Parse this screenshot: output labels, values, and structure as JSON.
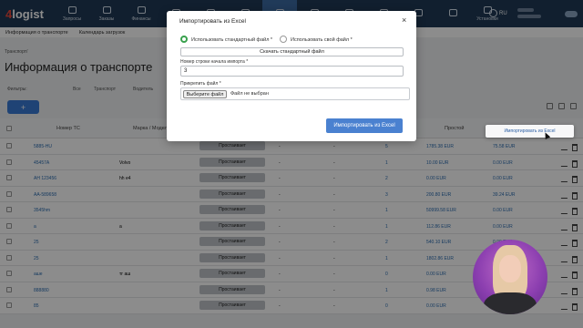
{
  "app": {
    "logo_prefix": "4",
    "logo_text": "logist"
  },
  "nav": {
    "items": [
      "Запросы",
      "Заказы",
      "Финансы",
      "",
      "",
      "",
      "",
      "",
      "",
      "",
      "",
      "",
      "Установки"
    ],
    "active_index": 6
  },
  "header": {
    "lang": "RU"
  },
  "subtabs": [
    "Информация о транспорте",
    "Календарь загрузок"
  ],
  "breadcrumb": "Транспорт/",
  "page_title": "Информация о транспорте",
  "filters": {
    "label": "Фильтры:",
    "options": [
      "Все",
      "Транспорт",
      "Водитель"
    ]
  },
  "add_button": "+",
  "table": {
    "headers": {
      "num": "Номер ТС",
      "brand": "Марка / Модель",
      "idle": "Простой"
    },
    "rows": [
      {
        "num": "5885-HU",
        "brand": "",
        "status": "Простаивает",
        "a": "-",
        "b": "-",
        "count": "5",
        "idle": "1785.38 EUR",
        "idle2": "75.58 EUR"
      },
      {
        "num": "45457А",
        "brand": "Volvo",
        "status": "Простаивает",
        "a": "-",
        "b": "-",
        "count": "1",
        "idle": "10.00 EUR",
        "idle2": "0.00 EUR"
      },
      {
        "num": "АН 123456",
        "brand": "hh e4",
        "status": "Простаивает",
        "a": "-",
        "b": "-",
        "count": "2",
        "idle": "0.00 EUR",
        "idle2": "0.00 EUR"
      },
      {
        "num": "АА-589658",
        "brand": "",
        "status": "Простаивает",
        "a": "-",
        "b": "-",
        "count": "3",
        "idle": "200.80 EUR",
        "idle2": "39.24 EUR"
      },
      {
        "num": "3545hm",
        "brand": "",
        "status": "Простаивает",
        "a": "-",
        "b": "-",
        "count": "1",
        "idle": "50999.58 EUR",
        "idle2": "0.00 EUR"
      },
      {
        "num": "a",
        "brand": "a",
        "status": "Простаивает",
        "a": "-",
        "b": "-",
        "count": "1",
        "idle": "112.86 EUR",
        "idle2": "0.00 EUR"
      },
      {
        "num": "25",
        "brand": "",
        "status": "Простаивает",
        "a": "-",
        "b": "-",
        "count": "2",
        "idle": "540.10 EUR",
        "idle2": "0.00 EUR"
      },
      {
        "num": "25",
        "brand": "",
        "status": "Простаивает",
        "a": "-",
        "b": "-",
        "count": "1",
        "idle": "1802.86 EUR",
        "idle2": "0.00 EUR"
      },
      {
        "num": "аше",
        "brand": "тг аш",
        "status": "Простаивает",
        "a": "-",
        "b": "-",
        "count": "0",
        "idle": "0.00 EUR",
        "idle2": "0.00 EUR"
      },
      {
        "num": "888880",
        "brand": "",
        "status": "Простаивает",
        "a": "-",
        "b": "-",
        "count": "1",
        "idle": "0.98 EUR",
        "idle2": "0.00 EUR"
      },
      {
        "num": "85",
        "brand": "",
        "status": "Простаивает",
        "a": "-",
        "b": "-",
        "count": "0",
        "idle": "0.00 EUR",
        "idle2": "0.00 EUR"
      }
    ]
  },
  "modal": {
    "title": "Импортировать из Excel",
    "close": "×",
    "radio_standard": "Использовать стандартный файл *",
    "radio_custom": "Использовать свой файл *",
    "download_btn": "Скачать стандартный файл",
    "start_row_label": "Номер строки начала импорта *",
    "start_row_value": "3",
    "attach_label": "Прикрепить файл *",
    "choose_file_btn": "Выберите файл",
    "no_file_text": "Файл не выбран",
    "import_btn": "Импортировать из Excel"
  },
  "popover": {
    "text": "Импортировать из Excel"
  }
}
